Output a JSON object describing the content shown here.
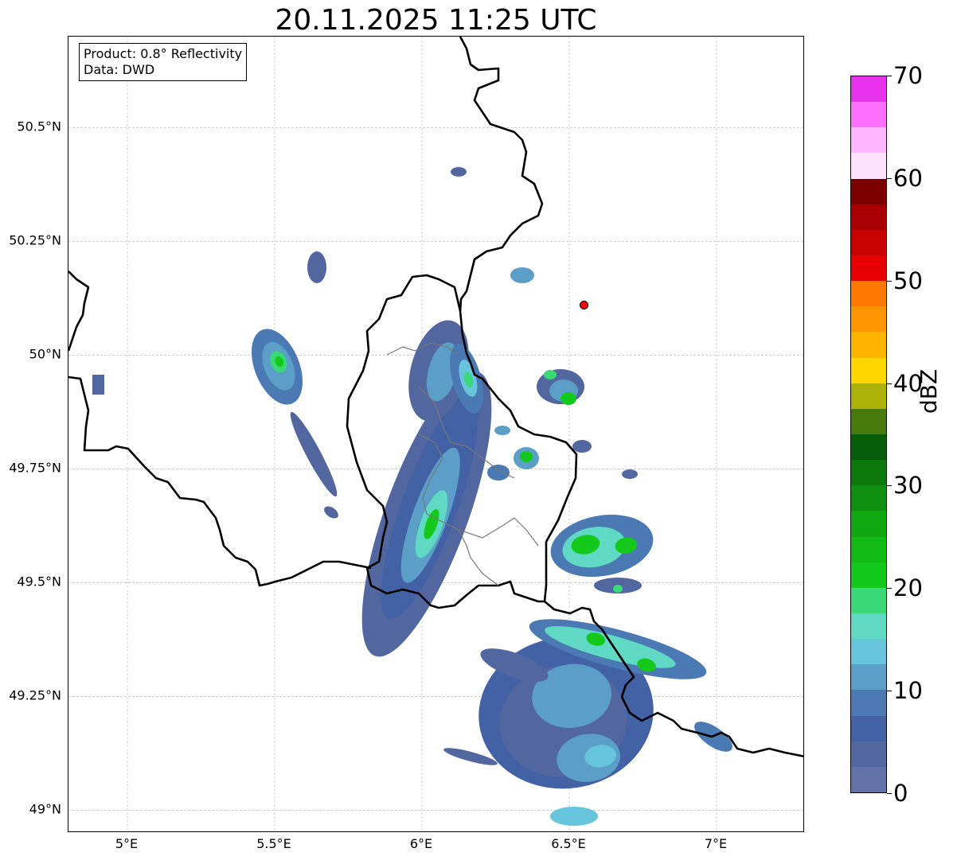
{
  "title": "20.11.2025 11:25 UTC",
  "info_box": {
    "product": "Product: 0.8° Reflectivity",
    "source": "Data: DWD"
  },
  "map": {
    "lon_range": [
      4.8,
      7.3
    ],
    "lat_range": [
      48.95,
      50.7
    ],
    "grid": true,
    "lat_ticks": [
      {
        "value": 49.0,
        "label": "49°N"
      },
      {
        "value": 49.25,
        "label": "49.25°N"
      },
      {
        "value": 49.5,
        "label": "49.5°N"
      },
      {
        "value": 49.75,
        "label": "49.75°N"
      },
      {
        "value": 50.0,
        "label": "50°N"
      },
      {
        "value": 50.25,
        "label": "50.25°N"
      },
      {
        "value": 50.5,
        "label": "50.5°N"
      }
    ],
    "lon_ticks": [
      {
        "value": 5.0,
        "label": "5°E"
      },
      {
        "value": 5.5,
        "label": "5.5°E"
      },
      {
        "value": 6.0,
        "label": "6°E"
      },
      {
        "value": 6.5,
        "label": "6.5°E"
      },
      {
        "value": 7.0,
        "label": "7°E"
      }
    ],
    "radar_site": {
      "lon": 6.55,
      "lat": 50.11,
      "color": "#ff0000"
    }
  },
  "colorbar": {
    "label": "dBZ",
    "min": 0,
    "max": 70,
    "ticks": [
      {
        "value": 0,
        "label": "0"
      },
      {
        "value": 10,
        "label": "10"
      },
      {
        "value": 20,
        "label": "20"
      },
      {
        "value": 30,
        "label": "30"
      },
      {
        "value": 40,
        "label": "40"
      },
      {
        "value": 50,
        "label": "50"
      },
      {
        "value": 60,
        "label": "60"
      },
      {
        "value": 70,
        "label": "70"
      }
    ],
    "colors": [
      "#6272a8",
      "#52679f",
      "#4361a5",
      "#4a79b3",
      "#5b9ec7",
      "#66c4dc",
      "#5fd8c4",
      "#3ad877",
      "#14c91b",
      "#12ba16",
      "#11a812",
      "#0f8e10",
      "#0b780c",
      "#065f08",
      "#477a0b",
      "#adb108",
      "#ffd700",
      "#ffb500",
      "#ff9500",
      "#ff7a00",
      "#e60000",
      "#c70000",
      "#a80000",
      "#7d0000",
      "#ffe0ff",
      "#ffb5ff",
      "#ff70ff",
      "#e833ee"
    ]
  }
}
